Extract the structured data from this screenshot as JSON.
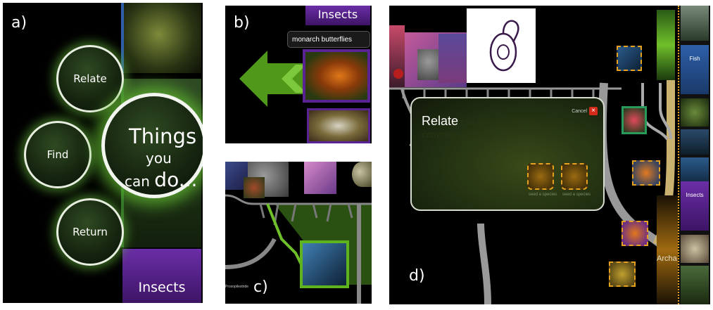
{
  "panel_a": {
    "label": "a)",
    "menu": {
      "relate": "Relate",
      "find": "Find",
      "return": "Return"
    },
    "hub": {
      "line1": "Things",
      "line2": "you",
      "line3a": "can ",
      "line3b": "do..."
    },
    "tab": "Insects"
  },
  "panel_b": {
    "label": "b)",
    "tab": "Insects",
    "tooltip": "monarch butterflies"
  },
  "panel_c": {
    "label": "c)",
    "tiny_text": "Prosopilestride"
  },
  "panel_d": {
    "label": "d)",
    "dialog": {
      "title": "Relate",
      "subtitle_rest": " two species and find their common ancestor",
      "cancel_label": "Cancel",
      "close_glyph": "×",
      "seed_a": "seed a species",
      "seed_b": "seed a species"
    },
    "side_tabs": {
      "fish": "Fish",
      "insects": "Insects"
    },
    "side_text": "Archa"
  },
  "colors": {
    "accent_green": "#6fbf2a",
    "insect_purple": "#5a2394",
    "seed_orange": "#e6a21e",
    "close_red": "#d42a1a"
  }
}
